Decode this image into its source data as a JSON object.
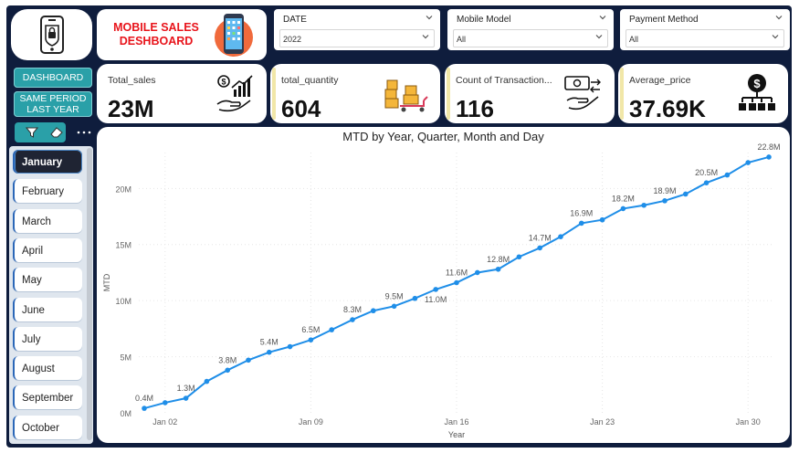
{
  "header": {
    "title": "MOBILE SALES DESHBOARD",
    "icons": [
      "phone-lock-icon",
      "smartphone-apps-icon"
    ]
  },
  "filters": [
    {
      "label": "DATE",
      "value": "2022"
    },
    {
      "label": "Mobile Model",
      "value": "All"
    },
    {
      "label": "Payment Method",
      "value": "All"
    }
  ],
  "nav": {
    "dashboard_label": "DASHBOARD",
    "same_period_label": "SAME PERIOD LAST YEAR"
  },
  "kpis": [
    {
      "label": "Total_sales",
      "value": "23M",
      "icon": "money-growth-hand-icon"
    },
    {
      "label": "total_quantity",
      "value": "604",
      "icon": "boxes-trolley-icon"
    },
    {
      "label": "Count of Transaction...",
      "value": "116",
      "icon": "cash-transfer-icon"
    },
    {
      "label": "Average_price",
      "value": "37.69K",
      "icon": "dollar-hierarchy-icon"
    }
  ],
  "slicer": {
    "months": [
      "January",
      "February",
      "March",
      "April",
      "May",
      "June",
      "July",
      "August",
      "September",
      "October"
    ],
    "selected": "January"
  },
  "chart_data": {
    "type": "line",
    "title": "MTD by Year, Quarter, Month and Day",
    "xlabel": "Year",
    "ylabel": "MTD",
    "x_ticks": [
      "Jan 02",
      "Jan 09",
      "Jan 16",
      "Jan 23",
      "Jan 30"
    ],
    "y_ticks": [
      "0M",
      "5M",
      "10M",
      "15M",
      "20M"
    ],
    "ylim": [
      0,
      23
    ],
    "color": "#1f8ee8",
    "x": [
      "Jan 01",
      "Jan 02",
      "Jan 03",
      "Jan 04",
      "Jan 05",
      "Jan 06",
      "Jan 07",
      "Jan 08",
      "Jan 09",
      "Jan 10",
      "Jan 11",
      "Jan 12",
      "Jan 13",
      "Jan 14",
      "Jan 15",
      "Jan 16",
      "Jan 17",
      "Jan 18",
      "Jan 19",
      "Jan 20",
      "Jan 21",
      "Jan 22",
      "Jan 23",
      "Jan 24",
      "Jan 25",
      "Jan 26",
      "Jan 27",
      "Jan 28",
      "Jan 29",
      "Jan 30",
      "Jan 31"
    ],
    "values": [
      0.4,
      0.9,
      1.3,
      2.8,
      3.8,
      4.7,
      5.4,
      5.9,
      6.5,
      7.4,
      8.3,
      9.1,
      9.5,
      10.2,
      11.0,
      11.6,
      12.5,
      12.8,
      13.9,
      14.7,
      15.7,
      16.9,
      17.2,
      18.2,
      18.5,
      18.9,
      19.5,
      20.5,
      21.2,
      22.3,
      22.8
    ],
    "data_labels": [
      {
        "i": 0,
        "text": "0.4M"
      },
      {
        "i": 2,
        "text": "1.3M"
      },
      {
        "i": 4,
        "text": "3.8M"
      },
      {
        "i": 6,
        "text": "5.4M"
      },
      {
        "i": 8,
        "text": "6.5M"
      },
      {
        "i": 10,
        "text": "8.3M"
      },
      {
        "i": 12,
        "text": "9.5M"
      },
      {
        "i": 14,
        "text": "11.0M",
        "below": true
      },
      {
        "i": 15,
        "text": "11.6M"
      },
      {
        "i": 17,
        "text": "12.8M"
      },
      {
        "i": 19,
        "text": "14.7M"
      },
      {
        "i": 21,
        "text": "16.9M"
      },
      {
        "i": 23,
        "text": "18.2M"
      },
      {
        "i": 25,
        "text": "18.9M"
      },
      {
        "i": 27,
        "text": "20.5M"
      },
      {
        "i": 30,
        "text": "22.8M"
      }
    ],
    "grid": true
  }
}
